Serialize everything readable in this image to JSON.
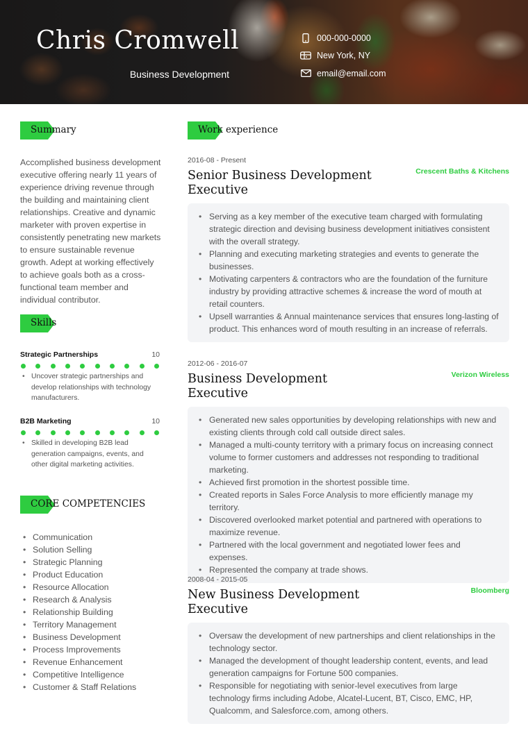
{
  "header": {
    "name": "Chris Cromwell",
    "role": "Business Development",
    "contacts": [
      {
        "icon": "phone-icon",
        "value": "000-000-0000"
      },
      {
        "icon": "mailbox-icon",
        "value": "New York, NY"
      },
      {
        "icon": "envelope-icon",
        "value": "email@email.com"
      }
    ]
  },
  "colors": {
    "accent": "#2ecc40",
    "box_background": "#f3f4f6"
  },
  "summary": {
    "heading": "Summary",
    "text": "Accomplished business development executive offering nearly 11 years of experience driving revenue through the building and maintaining client relationships. Creative and dynamic marketer with proven expertise in consistently penetrating new markets to ensure sustainable revenue growth. Adept at working effectively to achieve goals both as a cross-functional team member and individual contributor."
  },
  "skills": {
    "heading": "Skills",
    "items": [
      {
        "name": "Strategic Partnerships",
        "level": "10",
        "level_fraction": 1.0,
        "bullets": [
          "Uncover strategic partnerships and develop relationships with technology manufacturers."
        ]
      },
      {
        "name": "B2B Marketing",
        "level": "10",
        "level_fraction": 1.0,
        "bullets": [
          "Skilled in developing B2B lead generation campaigns, events, and other digital marketing activities."
        ]
      }
    ]
  },
  "competencies": {
    "heading": "CORE COMPETENCIES",
    "items": [
      "Communication",
      "Solution Selling",
      "Strategic Planning",
      "Product Education",
      "Resource Allocation",
      "Research & Analysis",
      "Relationship Building",
      "Territory Management",
      "Business Development",
      "Process Improvements",
      "Revenue Enhancement",
      "Competitive Intelligence",
      "Customer & Staff Relations"
    ]
  },
  "work": {
    "heading": "Work experience",
    "jobs": [
      {
        "dates": "2016-08 - Present",
        "title": "Senior Business Development Executive",
        "company": "Crescent Baths & Kitchens",
        "bullets": [
          "Serving as a key member of the executive team charged with formulating strategic direction and devising business development initiatives consistent with the overall strategy.",
          "Planning and executing marketing strategies and events to generate the businesses.",
          "Motivating carpenters & contractors who are the foundation of the furniture industry by providing attractive schemes & increase the word of mouth at retail counters.",
          "Upsell warranties & Annual maintenance services that ensures long-lasting of product. This enhances word of mouth resulting in an increase of referrals."
        ]
      },
      {
        "dates": "2012-06 - 2016-07",
        "title": "Business Development Executive",
        "company": "Verizon Wireless",
        "bullets": [
          "Generated new sales opportunities by developing relationships with new and existing clients through cold call outside direct sales.",
          "Managed a multi-county territory with a primary focus on increasing connect volume to former customers and addresses not responding to traditional marketing.",
          "Achieved first promotion in the shortest possible time.",
          "Created reports in Sales Force Analysis to more efficiently manage my territory.",
          "Discovered overlooked market potential and partnered with operations to maximize revenue.",
          "Partnered with the local government and negotiated lower fees and expenses.",
          "Represented the company at trade shows."
        ]
      },
      {
        "dates": "2008-04 - 2015-05",
        "title": "New Business Development Executive",
        "company": "Bloomberg",
        "bullets": [
          "Oversaw the development of new partnerships and client relationships in the technology sector.",
          "Managed the development of thought leadership content, events, and lead generation campaigns for Fortune 500 companies.",
          "Responsible for negotiating with senior-level executives from large technology firms including Adobe, Alcatel-Lucent, BT, Cisco, EMC, HP, Qualcomm, and Salesforce.com, among others."
        ]
      }
    ]
  }
}
